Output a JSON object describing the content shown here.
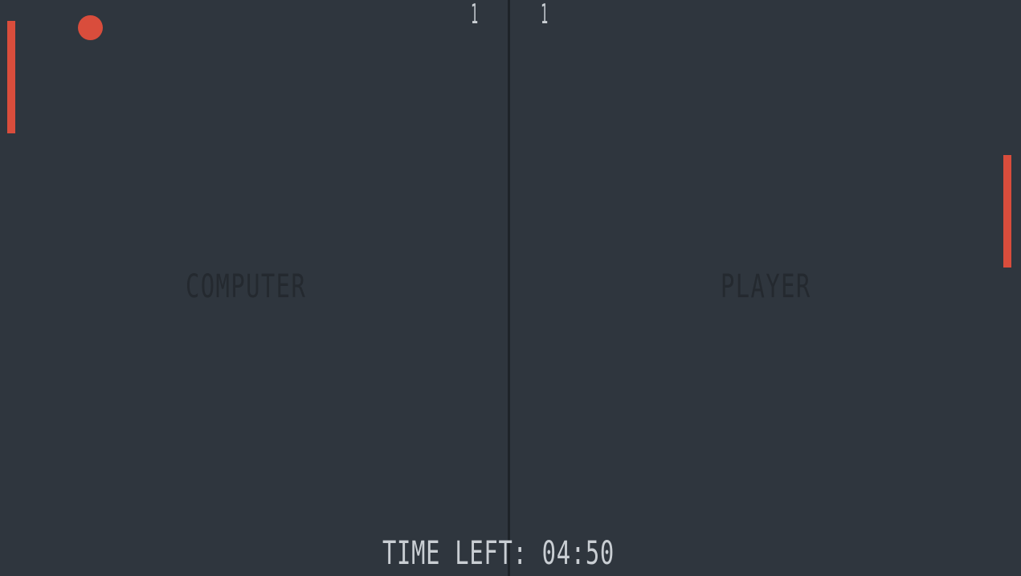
{
  "game": {
    "scores": {
      "computer": "1",
      "player": "1"
    },
    "labels": {
      "computer": "COMPUTER",
      "player": "PLAYER"
    },
    "timer": {
      "text": "TIME LEFT: 04:50"
    },
    "colors": {
      "background": "#2f363e",
      "paddle": "#d94d3c",
      "ball": "#d94d3c",
      "divider": "#1e2328",
      "score_text": "#c9ced3",
      "side_label_text": "#24292f"
    }
  }
}
